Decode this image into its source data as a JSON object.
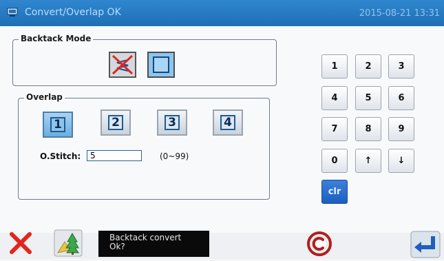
{
  "header": {
    "title": "Convert/Overlap  OK",
    "datetime": "2015-08-21 13:31"
  },
  "backtack_mode": {
    "label": "Backtack Mode",
    "buttons": [
      {
        "icon": "backtack-disabled-icon"
      },
      {
        "icon": "backtack-convert-icon"
      }
    ]
  },
  "overlap": {
    "label": "Overlap",
    "options": [
      "1",
      "2",
      "3",
      "4"
    ],
    "selected": "1",
    "stitch_label": "O.Stitch:",
    "stitch_value": "5",
    "stitch_range": "(0~99)"
  },
  "keypad": {
    "keys": [
      "1",
      "2",
      "3",
      "4",
      "5",
      "6",
      "7",
      "8",
      "9",
      "0",
      "↑",
      "↓"
    ],
    "clear": "clr"
  },
  "footer": {
    "message_line1": "Backtack convert",
    "message_line2": "Ok?"
  },
  "colors": {
    "titlebar": "#2477c2",
    "clr_key": "#2a6fd0",
    "cancel_red": "#e0261f"
  }
}
